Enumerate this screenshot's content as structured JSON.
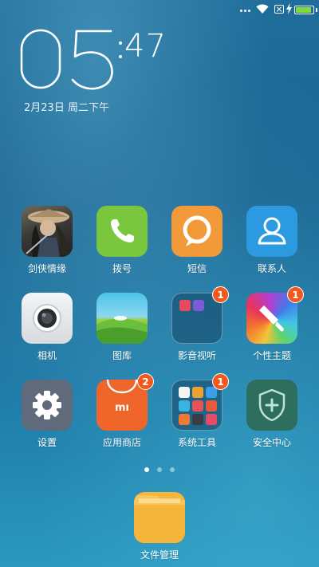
{
  "status_bar": {
    "icons": [
      "more-dots-icon",
      "wifi-icon",
      "no-sim-icon",
      "charging-bolt-icon",
      "battery-icon"
    ],
    "battery_color": "#7ddc3c",
    "battery_level": 0.9
  },
  "clock": {
    "hour": "05",
    "minute": "47",
    "date": "2月23日 周二下午"
  },
  "apps": [
    {
      "label": "剑侠情缘",
      "icon": "game-warrior-icon"
    },
    {
      "label": "拨号",
      "icon": "phone-icon",
      "color": "#7ac63d"
    },
    {
      "label": "短信",
      "icon": "message-icon",
      "color": "#f29a3a"
    },
    {
      "label": "联系人",
      "icon": "contacts-icon",
      "color": "#2b9ae0"
    },
    {
      "label": "相机",
      "icon": "camera-icon",
      "color": "#e9ecef"
    },
    {
      "label": "图库",
      "icon": "gallery-icon",
      "color": "#55c1e8"
    },
    {
      "label": "影音视听",
      "icon": "media-folder-icon",
      "badge": "1"
    },
    {
      "label": "个性主题",
      "icon": "theme-brush-icon",
      "badge": "1"
    },
    {
      "label": "设置",
      "icon": "gear-icon",
      "color": "#5f6b7a"
    },
    {
      "label": "应用商店",
      "icon": "mi-store-icon",
      "color": "#f0652a",
      "badge": "2"
    },
    {
      "label": "系统工具",
      "icon": "tools-folder-icon",
      "badge": "1"
    },
    {
      "label": "安全中心",
      "icon": "shield-plus-icon",
      "color": "#2e6e5e"
    }
  ],
  "pages": {
    "count": 3,
    "active": 0
  },
  "dock": {
    "label": "文件管理",
    "icon": "file-folder-icon",
    "color": "#f5b63b"
  }
}
